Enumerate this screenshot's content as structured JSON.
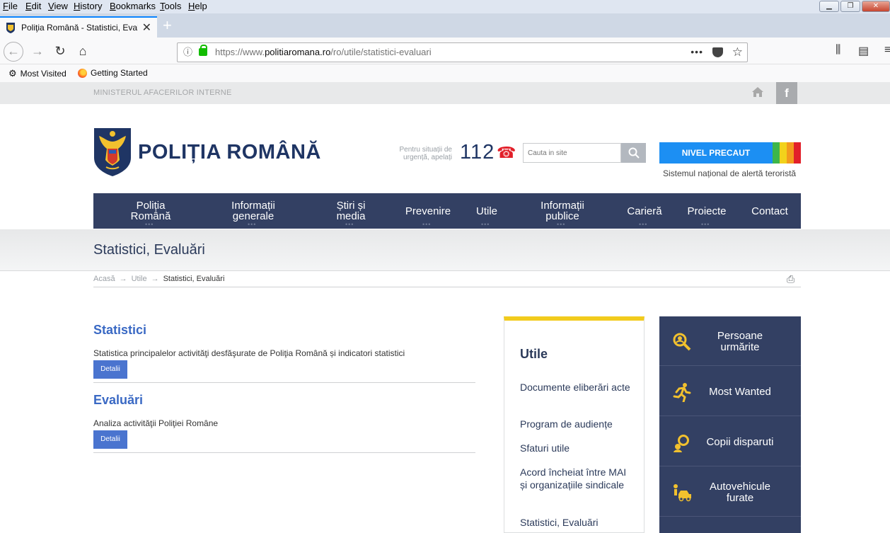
{
  "browser": {
    "menu": [
      "File",
      "Edit",
      "View",
      "History",
      "Bookmarks",
      "Tools",
      "Help"
    ],
    "tab_title": "Poliţia Română - Statistici, Eval",
    "url_prefix": "https://www.",
    "url_domain": "politiaromana.ro",
    "url_path": "/ro/utile/statistici-evaluari",
    "bookmarks": [
      "Most Visited",
      "Getting Started"
    ]
  },
  "header": {
    "ministry": "MINISTERUL AFACERILOR INTERNE",
    "site_title": "POLIȚIA ROMÂNĂ",
    "emergency_text": "Pentru situații de urgență, apelați",
    "emergency_number": "112",
    "search_placeholder": "Cauta in site",
    "alert_label": "NIVEL PRECAUT",
    "alert_sub": "Sistemul național de alertă teroristă",
    "alert_colors": [
      "#3db64a",
      "#f2d21b",
      "#f39a1d",
      "#e2202a"
    ]
  },
  "nav": [
    {
      "label": "Poliția Română",
      "dots": true
    },
    {
      "label": "Informații generale",
      "dots": true
    },
    {
      "label": "Știri și media",
      "dots": true
    },
    {
      "label": "Prevenire",
      "dots": true
    },
    {
      "label": "Utile",
      "dots": true
    },
    {
      "label": "Informații publice",
      "dots": true
    },
    {
      "label": "Carieră",
      "dots": true
    },
    {
      "label": "Proiecte",
      "dots": true
    },
    {
      "label": "Contact",
      "dots": false
    }
  ],
  "page": {
    "title": "Statistici, Evaluări",
    "breadcrumb": [
      "Acasă",
      "Utile",
      "Statistici, Evaluări"
    ],
    "sections": [
      {
        "title": "Statistici",
        "desc": "Statistica principalelor activităţi desfăşurate de Poliţia Română și indicatori statistici",
        "button": "Detalii"
      },
      {
        "title": "Evaluări",
        "desc": "Analiza activităţii Poliţiei Române",
        "button": "Detalii"
      }
    ]
  },
  "utile": {
    "heading": "Utile",
    "links": [
      "Documente eliberări acte",
      "Program de audiențe",
      "Sfaturi utile",
      "Acord încheiat între MAI și organizațiile sindicale",
      "Statistici, Evaluări"
    ]
  },
  "side": [
    {
      "label": "Persoane urmărite",
      "icon": "search-person-icon"
    },
    {
      "label": "Most Wanted",
      "icon": "running-man-icon"
    },
    {
      "label": "Copii disparuti",
      "icon": "missing-child-icon"
    },
    {
      "label": "Autovehicule furate",
      "icon": "stolen-car-icon"
    }
  ]
}
